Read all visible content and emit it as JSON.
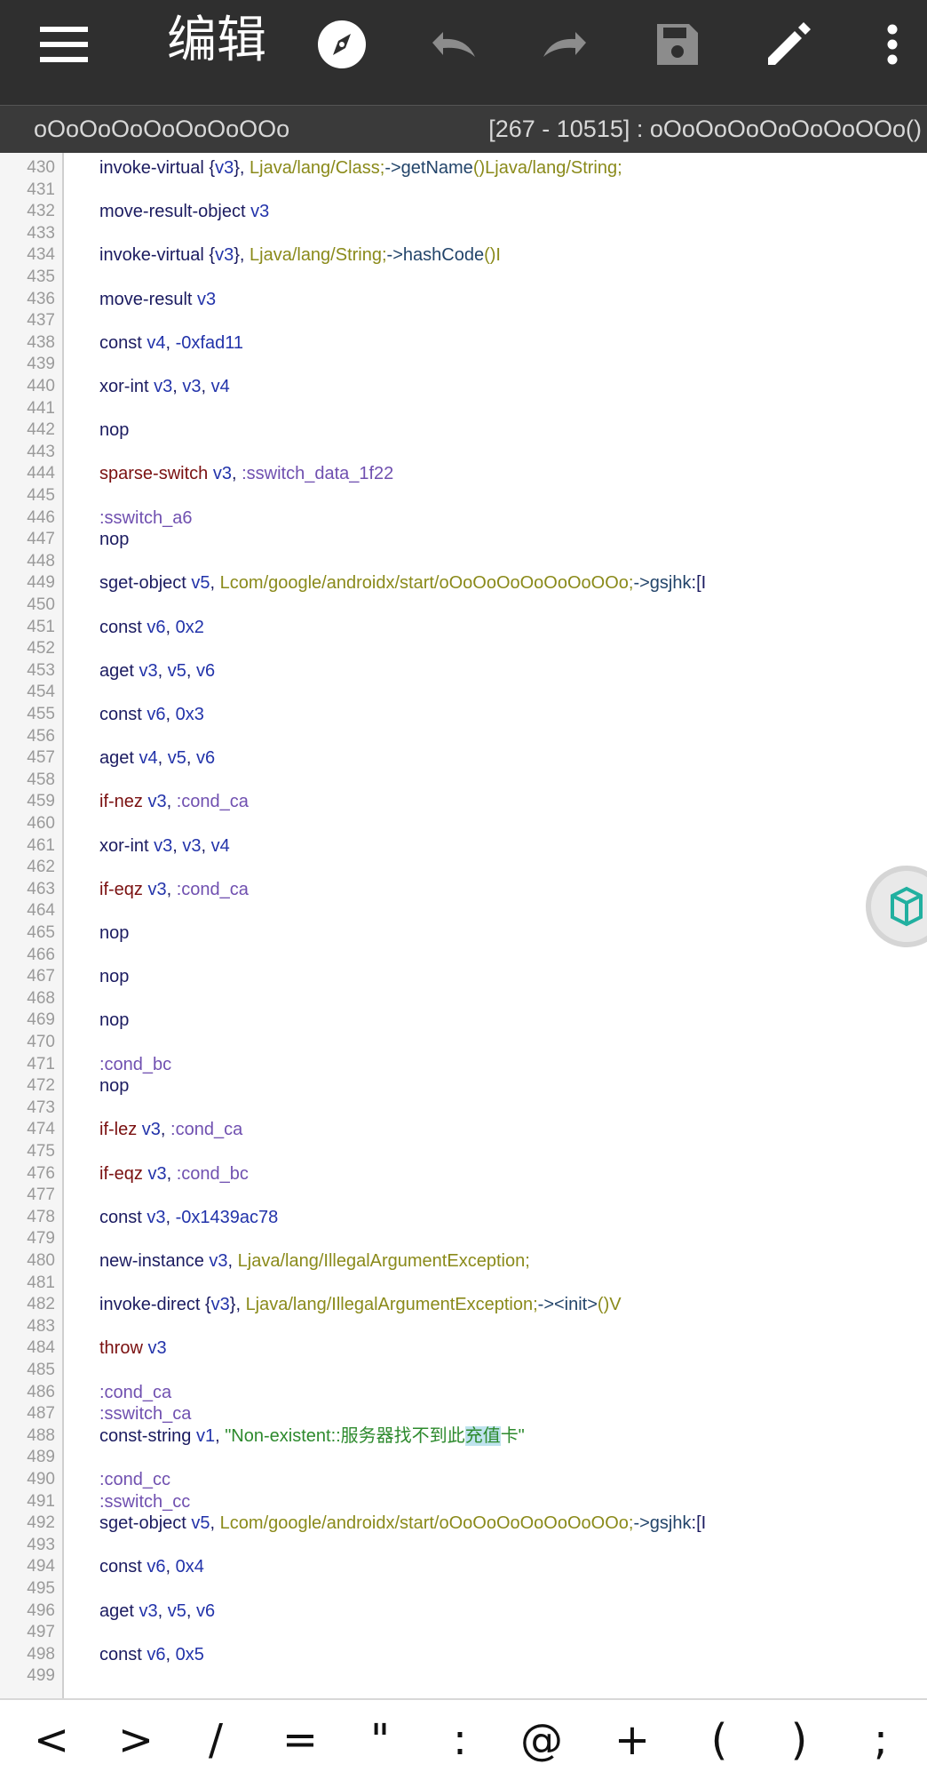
{
  "appbar": {
    "title": "编辑",
    "icons": [
      "menu-icon",
      "compass-icon",
      "undo-icon",
      "redo-icon",
      "save-icon",
      "edit-icon",
      "more-vert-icon"
    ]
  },
  "subbar": {
    "class_name": "oOoOoOoOoOoOoOOo",
    "range": "[267 - 10515] : oOoOoOoOoOoOoOOo()"
  },
  "lines": [
    {
      "n": "430",
      "t": "invoke-virtual  {v3}, Ljava/lang/Class;->getName()Ljava/lang/String;"
    },
    {
      "n": "431",
      "t": ""
    },
    {
      "n": "432",
      "t": "move-result-object  v3"
    },
    {
      "n": "433",
      "t": ""
    },
    {
      "n": "434",
      "t": "invoke-virtual  {v3}, Ljava/lang/String;->hashCode()I"
    },
    {
      "n": "435",
      "t": ""
    },
    {
      "n": "436",
      "t": "move-result  v3"
    },
    {
      "n": "437",
      "t": ""
    },
    {
      "n": "438",
      "t": "const  v4, -0xfad11"
    },
    {
      "n": "439",
      "t": ""
    },
    {
      "n": "440",
      "t": "xor-int  v3, v3, v4"
    },
    {
      "n": "441",
      "t": ""
    },
    {
      "n": "442",
      "t": "nop"
    },
    {
      "n": "443",
      "t": ""
    },
    {
      "n": "444",
      "t": "sparse-switch  v3, :sswitch_data_1f22"
    },
    {
      "n": "445",
      "t": ""
    },
    {
      "n": "446",
      "t": ":sswitch_a6"
    },
    {
      "n": "447",
      "t": "nop"
    },
    {
      "n": "448",
      "t": ""
    },
    {
      "n": "449",
      "t": "sget-object  v5, Lcom/google/androidx/start/oOoOoOoOoOoOoOOo;->gsjhk:[I"
    },
    {
      "n": "450",
      "t": ""
    },
    {
      "n": "451",
      "t": "const  v6, 0x2"
    },
    {
      "n": "452",
      "t": ""
    },
    {
      "n": "453",
      "t": "aget  v3, v5, v6"
    },
    {
      "n": "454",
      "t": ""
    },
    {
      "n": "455",
      "t": "const  v6, 0x3"
    },
    {
      "n": "456",
      "t": ""
    },
    {
      "n": "457",
      "t": "aget  v4, v5, v6"
    },
    {
      "n": "458",
      "t": ""
    },
    {
      "n": "459",
      "t": "if-nez  v3, :cond_ca"
    },
    {
      "n": "460",
      "t": ""
    },
    {
      "n": "461",
      "t": "xor-int  v3, v3, v4"
    },
    {
      "n": "462",
      "t": ""
    },
    {
      "n": "463",
      "t": "if-eqz  v3, :cond_ca"
    },
    {
      "n": "464",
      "t": ""
    },
    {
      "n": "465",
      "t": "nop"
    },
    {
      "n": "466",
      "t": ""
    },
    {
      "n": "467",
      "t": "nop"
    },
    {
      "n": "468",
      "t": ""
    },
    {
      "n": "469",
      "t": "nop"
    },
    {
      "n": "470",
      "t": ""
    },
    {
      "n": "471",
      "t": ":cond_bc"
    },
    {
      "n": "472",
      "t": "nop"
    },
    {
      "n": "473",
      "t": ""
    },
    {
      "n": "474",
      "t": "if-lez  v3, :cond_ca"
    },
    {
      "n": "475",
      "t": ""
    },
    {
      "n": "476",
      "t": "if-eqz  v3, :cond_bc"
    },
    {
      "n": "477",
      "t": ""
    },
    {
      "n": "478",
      "t": "const  v3, -0x1439ac78"
    },
    {
      "n": "479",
      "t": ""
    },
    {
      "n": "480",
      "t": "new-instance  v3, Ljava/lang/IllegalArgumentException;"
    },
    {
      "n": "481",
      "t": ""
    },
    {
      "n": "482",
      "t": "invoke-direct  {v3}, Ljava/lang/IllegalArgumentException;-><init>()V"
    },
    {
      "n": "483",
      "t": ""
    },
    {
      "n": "484",
      "t": "throw  v3"
    },
    {
      "n": "485",
      "t": ""
    },
    {
      "n": "486",
      "t": ":cond_ca"
    },
    {
      "n": "487",
      "t": ":sswitch_ca"
    },
    {
      "n": "488",
      "t": "const-string  v1, \"Non-existent::服务器找不到此充值卡\""
    },
    {
      "n": "489",
      "t": ""
    },
    {
      "n": "490",
      "t": ":cond_cc"
    },
    {
      "n": "491",
      "t": ":sswitch_cc"
    },
    {
      "n": "492",
      "t": "sget-object  v5, Lcom/google/androidx/start/oOoOoOoOoOoOoOOo;->gsjhk:[I"
    },
    {
      "n": "493",
      "t": ""
    },
    {
      "n": "494",
      "t": "const  v6, 0x4"
    },
    {
      "n": "495",
      "t": ""
    },
    {
      "n": "496",
      "t": "aget  v3, v5, v6"
    },
    {
      "n": "497",
      "t": ""
    },
    {
      "n": "498",
      "t": "const  v6, 0x5"
    },
    {
      "n": "499",
      "t": ""
    }
  ],
  "highlight": "充值",
  "symbols": [
    "<",
    ">",
    "/",
    "=",
    "\"",
    ":",
    "@",
    "+",
    "(",
    ")",
    ";"
  ],
  "colors": {
    "appbar": "#2f2f2f",
    "subbar": "#3a3a3a",
    "string": "#2d8a2d",
    "keyword_red": "#7a1010",
    "type": "#8a8a1a",
    "label": "#7050b0"
  }
}
